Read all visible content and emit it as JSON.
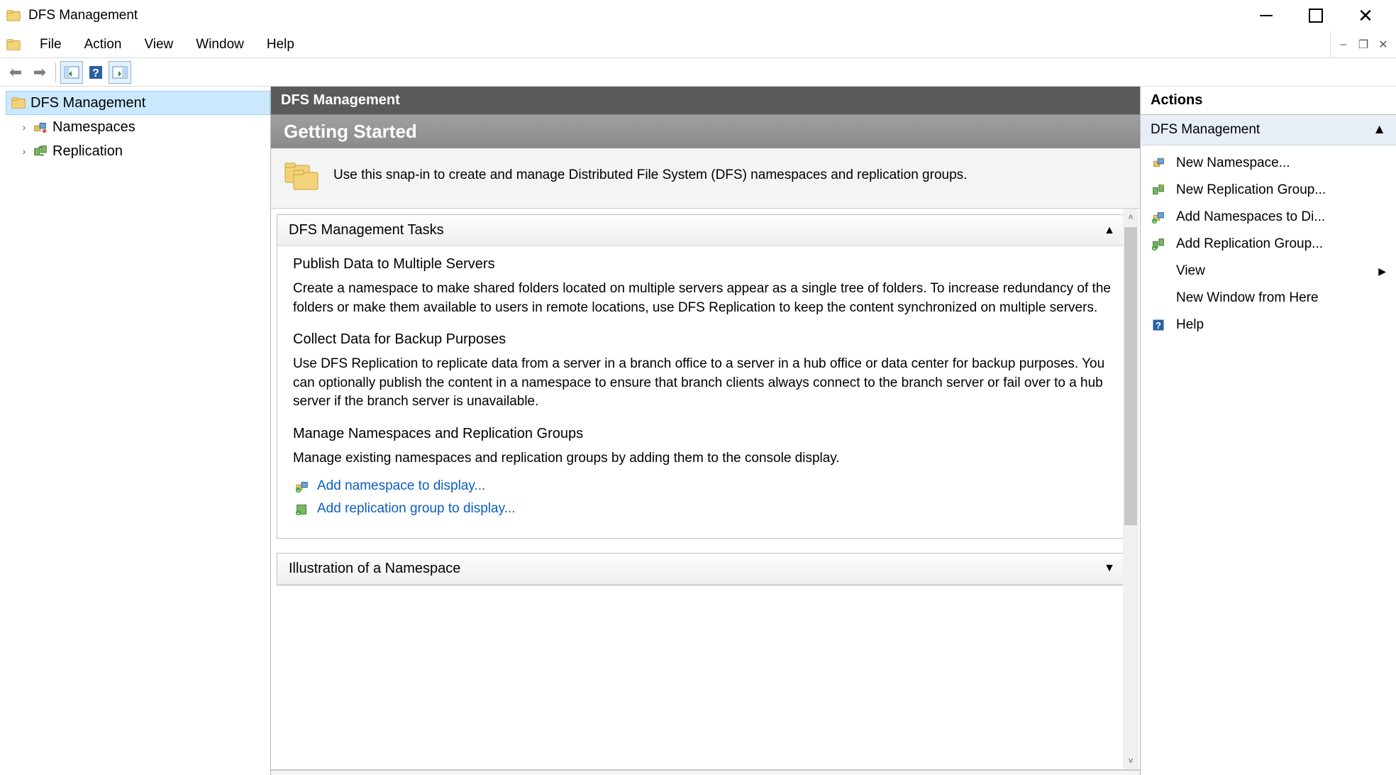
{
  "title": "DFS Management",
  "menu": {
    "file": "File",
    "action": "Action",
    "view": "View",
    "window": "Window",
    "help": "Help"
  },
  "tree": {
    "root": "DFS Management",
    "items": [
      "Namespaces",
      "Replication"
    ]
  },
  "center": {
    "header": "DFS Management",
    "getting_started": "Getting Started",
    "intro": "Use this snap-in to create and manage Distributed File System (DFS) namespaces and replication groups.",
    "tasks_panel_title": "DFS Management Tasks",
    "sections": [
      {
        "title": "Publish Data to Multiple Servers",
        "text": "Create a namespace to make shared folders located on multiple servers appear as a single tree of folders. To increase redundancy of the folders or make them available to users in remote locations, use DFS Replication to keep the content synchronized on multiple servers."
      },
      {
        "title": "Collect Data for Backup Purposes",
        "text": "Use DFS Replication to replicate data from a server in a branch office to a server in a hub office or data center for backup purposes. You can optionally publish the content in a namespace to ensure that branch clients always connect to the branch server or fail over to a hub server if the branch server is unavailable."
      },
      {
        "title": "Manage Namespaces and Replication Groups",
        "text": "Manage existing namespaces and replication groups by adding them to the console display."
      }
    ],
    "links": {
      "add_namespace": "Add namespace to display...",
      "add_replication": "Add replication group to display..."
    },
    "panel2_title": "Illustration of a Namespace"
  },
  "actions": {
    "title": "Actions",
    "group": "DFS Management",
    "items": {
      "new_namespace": "New Namespace...",
      "new_replication_group": "New Replication Group...",
      "add_namespaces": "Add Namespaces to Di...",
      "add_replication_group": "Add Replication Group...",
      "view": "View",
      "new_window": "New Window from Here",
      "help": "Help"
    }
  }
}
